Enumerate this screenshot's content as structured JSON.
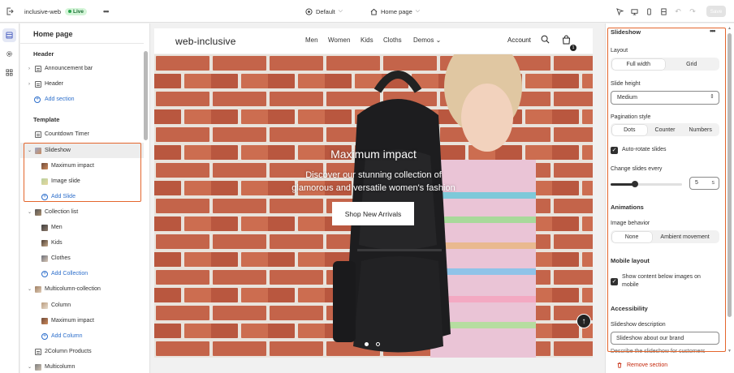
{
  "topbar": {
    "store_name": "inclusive-web",
    "live_label": "Live",
    "theme_label": "Default",
    "page_label": "Home page",
    "save_label": "Save"
  },
  "sidebar": {
    "title": "Home page",
    "header_group": "Header",
    "header_items": [
      "Announcement bar",
      "Header"
    ],
    "add_section": "Add section",
    "template_group": "Template",
    "countdown": "Countdown Timer",
    "slideshow": "Slideshow",
    "slideshow_children": [
      "Maximum impact",
      "Image slide"
    ],
    "add_slide": "Add Slide",
    "collection_list": "Collection list",
    "collection_children": [
      "Men",
      "Kids",
      "Clothes"
    ],
    "add_collection": "Add Collection",
    "multicolumn_collection": "Multicolumn-collection",
    "multicolumn_children": [
      "Column",
      "Maximum impact"
    ],
    "add_column": "Add Column",
    "two_column_products": "2Column Products",
    "multicolumn": "Multicolumn"
  },
  "preview": {
    "brand": "web-inclusive",
    "nav": [
      "Men",
      "Women",
      "Kids",
      "Cloths",
      "Demos"
    ],
    "account": "Account",
    "cart_count": "1",
    "hero_title": "Maximum impact",
    "hero_subtitle_line1": "Discover our stunning collection of",
    "hero_subtitle_line2": "glamorous and versatile women's fashion",
    "hero_button": "Shop New Arrivals",
    "slide_count": 2,
    "active_slide": 1
  },
  "settings": {
    "title": "Slideshow",
    "layout_label": "Layout",
    "layout_options": [
      "Full width",
      "Grid"
    ],
    "layout_selected": "Full width",
    "slide_height_label": "Slide height",
    "slide_height_value": "Medium",
    "pagination_label": "Pagination style",
    "pagination_options": [
      "Dots",
      "Counter",
      "Numbers"
    ],
    "pagination_selected": "Dots",
    "autorotate_label": "Auto-rotate slides",
    "autorotate_checked": true,
    "change_every_label": "Change slides every",
    "change_every_value": "5",
    "change_every_unit": "s",
    "change_every_fraction": 0.34,
    "animations_heading": "Animations",
    "image_behavior_label": "Image behavior",
    "image_behavior_options": [
      "None",
      "Ambient movement"
    ],
    "image_behavior_selected": "None",
    "mobile_heading": "Mobile layout",
    "mobile_check_label": "Show content below images on mobile",
    "mobile_check_checked": true,
    "accessibility_heading": "Accessibility",
    "description_label": "Slideshow description",
    "description_value": "Slideshow about our brand",
    "description_help": "Describe the slideshow for customers",
    "remove_label": "Remove section"
  },
  "colors": {
    "accent_blue": "#2c6ecb",
    "highlight_orange": "#e4662d",
    "live_green": "#2aa44f",
    "danger_red": "#c5280c"
  }
}
